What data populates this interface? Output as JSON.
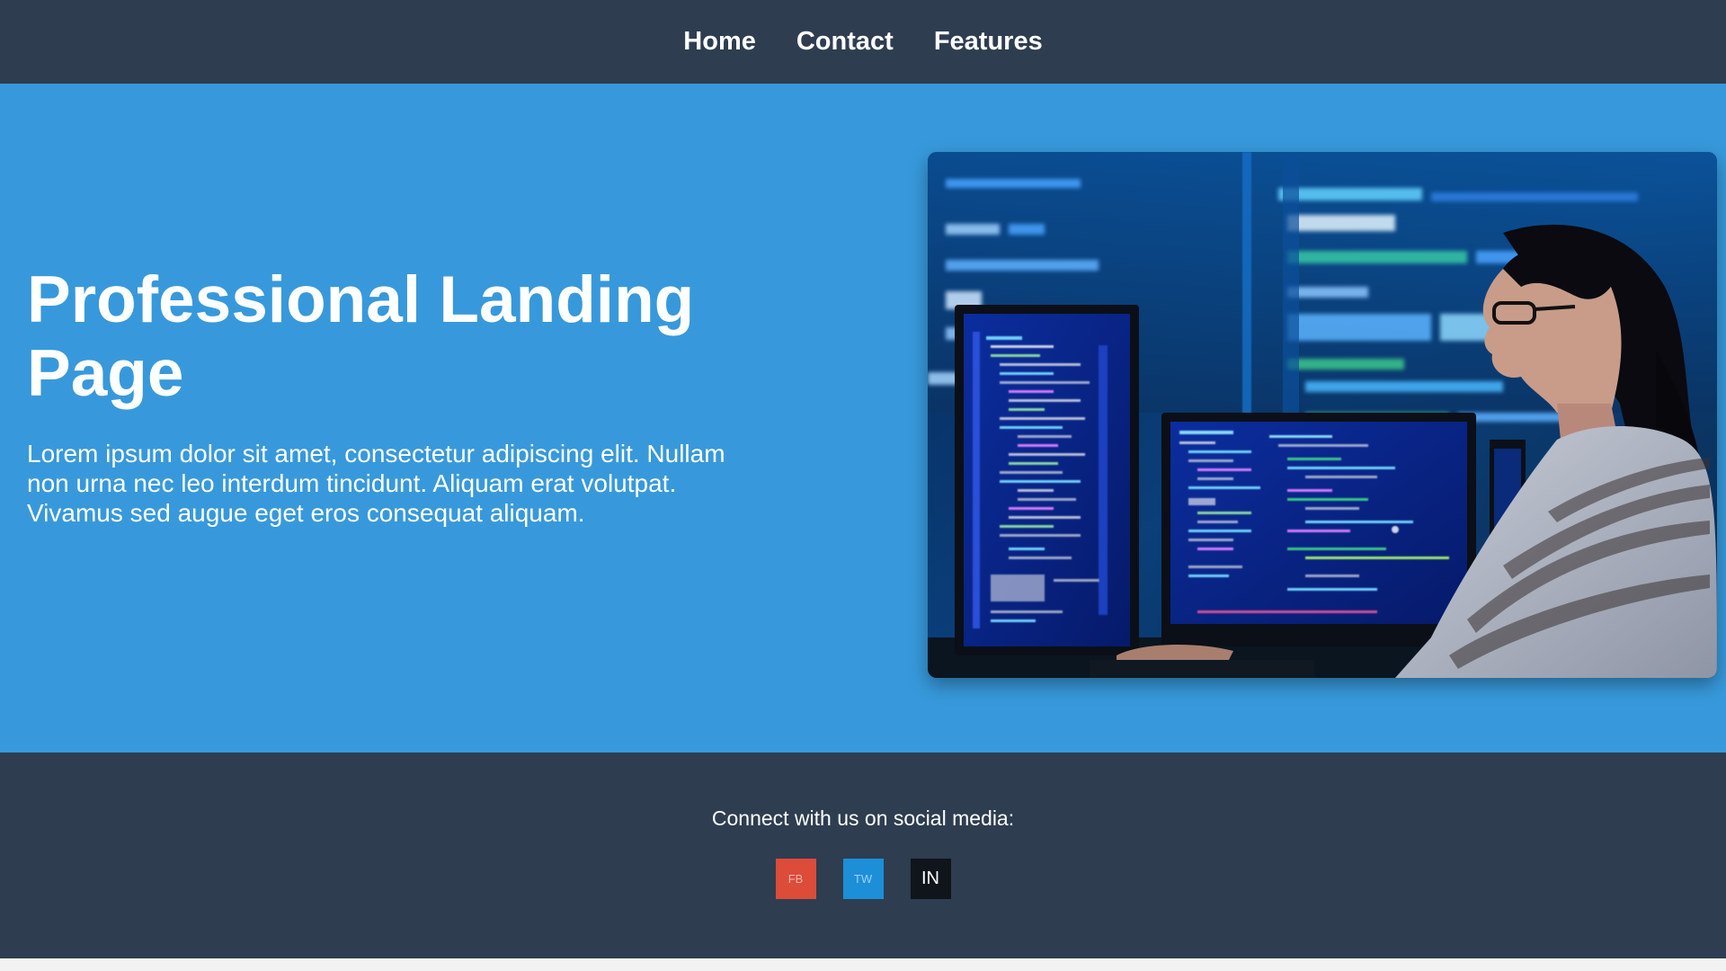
{
  "nav": {
    "items": [
      {
        "label": "Home"
      },
      {
        "label": "Contact"
      },
      {
        "label": "Features"
      }
    ]
  },
  "hero": {
    "title": "Professional Landing Page",
    "text": "Lorem ipsum dolor sit amet, consectetur adipiscing elit. Nullam non urna nec leo interdum tincidunt. Aliquam erat volutpat. Vivamus sed augue eget eros consequat aliquam."
  },
  "footer": {
    "text": "Connect with us on social media:",
    "social": [
      {
        "label": "FB",
        "icon": "facebook-icon",
        "color": "#dd4b39"
      },
      {
        "label": "TW",
        "icon": "twitter-icon",
        "color": "#1c8fd8"
      },
      {
        "label": "IN",
        "icon": "linkedin-icon",
        "color": "#10151c"
      }
    ]
  },
  "colors": {
    "nav_bg": "#2e3d50",
    "hero_bg": "#3799db",
    "footer_bg": "#2e3d50"
  }
}
